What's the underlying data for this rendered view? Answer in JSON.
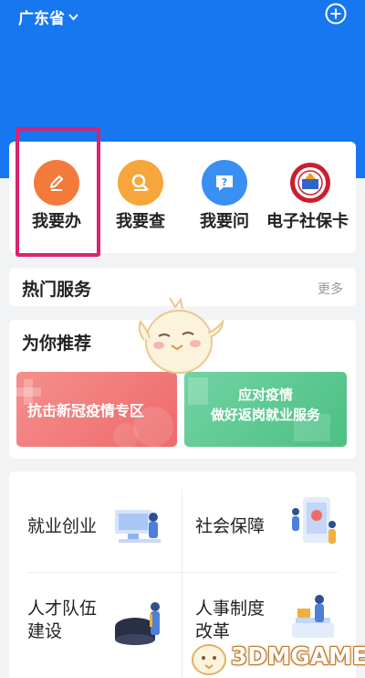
{
  "header": {
    "province": "广东省"
  },
  "quick_actions": [
    {
      "label": "我要办",
      "icon": "edit-icon",
      "color": "#f47a3c"
    },
    {
      "label": "我要查",
      "icon": "search-icon",
      "color": "#f6a63a"
    },
    {
      "label": "我要问",
      "icon": "question-icon",
      "color": "#3a8ff2"
    },
    {
      "label": "电子社保卡",
      "icon": "social-security-card-icon",
      "color": "#c8202f"
    }
  ],
  "hot_services": {
    "title": "热门服务",
    "more": "更多"
  },
  "recommend": {
    "title": "为你推荐",
    "banners": [
      {
        "text": "抗击新冠疫情专区"
      },
      {
        "text_line1": "应对疫情",
        "text_line2": "做好返岗就业服务"
      }
    ]
  },
  "categories": [
    {
      "label": "就业创业"
    },
    {
      "label": "社会保障"
    },
    {
      "label_line1": "人才队伍",
      "label_line2": "建设"
    },
    {
      "label_line1": "人事制度",
      "label_line2": "改革"
    }
  ],
  "watermark": {
    "text": "3DMGAME"
  }
}
